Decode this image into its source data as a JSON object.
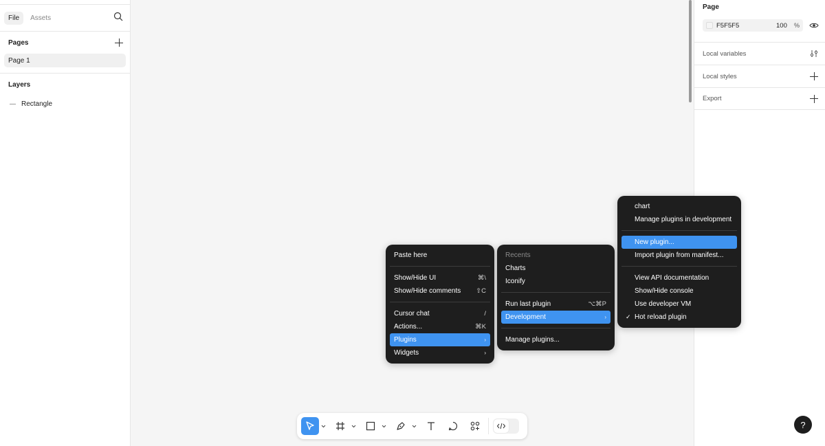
{
  "left_panel": {
    "tabs": [
      "File",
      "Assets"
    ],
    "pages_title": "Pages",
    "page_items": [
      "Page 1"
    ],
    "layers_title": "Layers",
    "layers": [
      "Rectangle"
    ]
  },
  "right_panel": {
    "title": "Page",
    "fill_hex": "F5F5F5",
    "fill_opacity": "100",
    "fill_pct": "%",
    "rows": [
      "Local variables",
      "Local styles",
      "Export"
    ]
  },
  "context_menu": {
    "items": [
      {
        "label": "Paste here",
        "shortcut": ""
      },
      {
        "label": "Show/Hide UI",
        "shortcut": "⌘\\"
      },
      {
        "label": "Show/Hide comments",
        "shortcut": "⇧C"
      },
      {
        "label": "Cursor chat",
        "shortcut": "/"
      },
      {
        "label": "Actions...",
        "shortcut": "⌘K"
      },
      {
        "label": "Plugins",
        "shortcut": "›"
      },
      {
        "label": "Widgets",
        "shortcut": "›"
      }
    ]
  },
  "plugins_menu": {
    "recents_label": "Recents",
    "items": [
      {
        "label": "Charts",
        "shortcut": ""
      },
      {
        "label": "Iconify",
        "shortcut": ""
      },
      {
        "label": "Run last plugin",
        "shortcut": "⌥⌘P"
      },
      {
        "label": "Development",
        "shortcut": "›"
      },
      {
        "label": "Manage plugins...",
        "shortcut": ""
      }
    ]
  },
  "dev_menu": {
    "items": [
      {
        "label": "chart",
        "checked": false
      },
      {
        "label": "Manage plugins in development",
        "checked": false
      },
      {
        "label": "New plugin...",
        "checked": false
      },
      {
        "label": "Import plugin from manifest...",
        "checked": false
      },
      {
        "label": "View API documentation",
        "checked": false
      },
      {
        "label": "Show/Hide console",
        "checked": false
      },
      {
        "label": "Use developer VM",
        "checked": false
      },
      {
        "label": "Hot reload plugin",
        "checked": true
      }
    ],
    "check_glyph": "✓"
  },
  "help_label": "?",
  "colors": {
    "accent": "#3f93f0",
    "menu_bg": "#1e1e1e",
    "canvas": "#f5f5f5"
  }
}
